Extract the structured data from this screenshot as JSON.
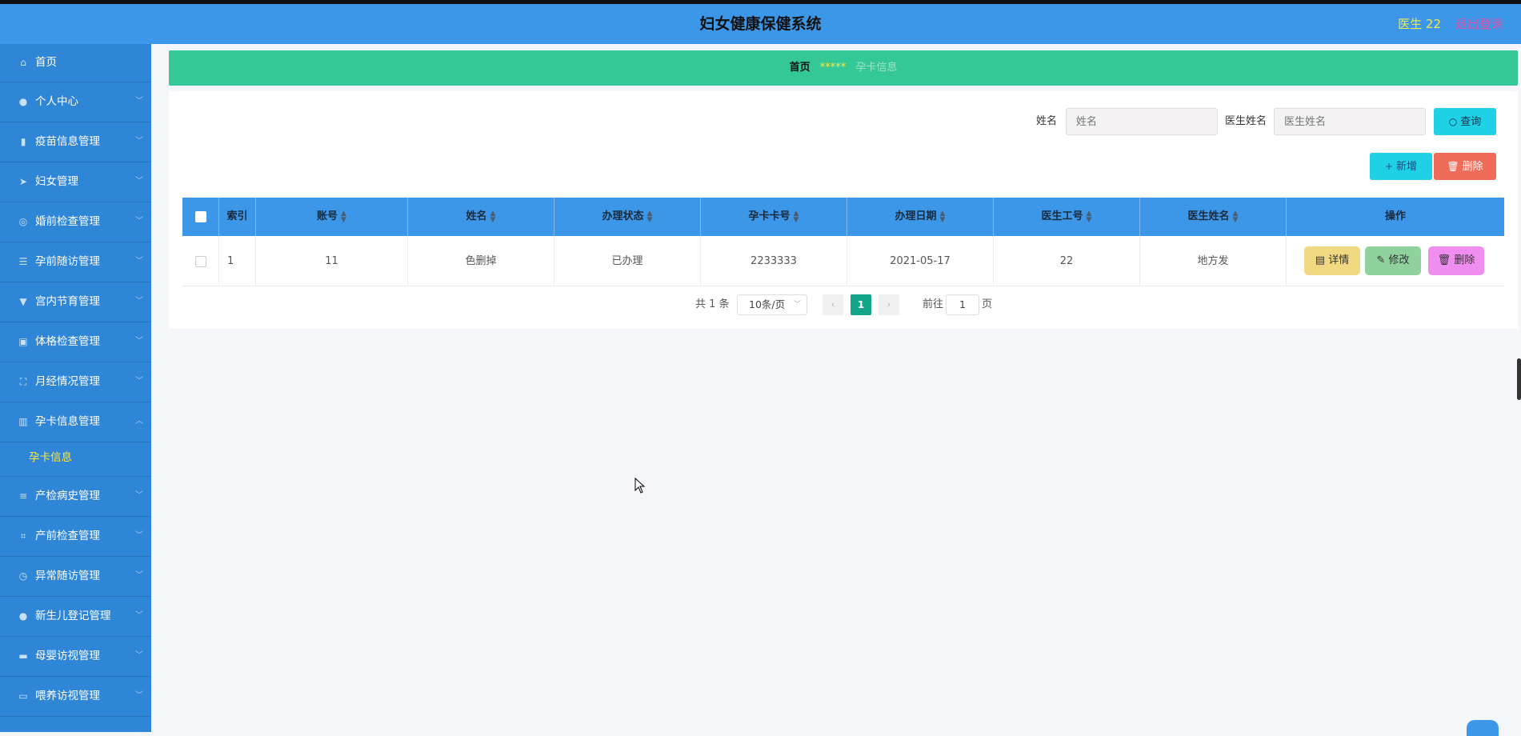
{
  "header": {
    "title": "妇女健康保健系统",
    "user": "医生 22",
    "logout": "退出登录"
  },
  "sidebar": {
    "items": [
      {
        "label": "首页",
        "icon": "home-icon"
      },
      {
        "label": "个人中心",
        "icon": "user-icon"
      },
      {
        "label": "疫苗信息管理",
        "icon": "microphone-icon"
      },
      {
        "label": "妇女管理",
        "icon": "send-icon"
      },
      {
        "label": "婚前检查管理",
        "icon": "compass-icon"
      },
      {
        "label": "孕前随访管理",
        "icon": "sliders-icon"
      },
      {
        "label": "宫内节育管理",
        "icon": "stamp-icon"
      },
      {
        "label": "体格检查管理",
        "icon": "clipboard-icon"
      },
      {
        "label": "月经情况管理",
        "icon": "fullscreen-icon"
      },
      {
        "label": "孕卡信息管理",
        "icon": "bar-chart-icon"
      },
      {
        "label": "产检病史管理",
        "icon": "list-icon"
      },
      {
        "label": "产前检查管理",
        "icon": "crop-icon"
      },
      {
        "label": "异常随访管理",
        "icon": "clock-icon"
      },
      {
        "label": "新生儿登记管理",
        "icon": "person-icon"
      },
      {
        "label": "母婴访视管理",
        "icon": "monitor-icon"
      },
      {
        "label": "喂养访视管理",
        "icon": "film-icon"
      }
    ],
    "sub_item": "孕卡信息"
  },
  "breadcrumb": {
    "home": "首页",
    "separator": "*****",
    "current": "孕卡信息"
  },
  "search": {
    "name_label": "姓名",
    "name_placeholder": "姓名",
    "doctor_label": "医生姓名",
    "doctor_placeholder": "医生姓名",
    "query_button": "查询"
  },
  "actions": {
    "add_button": "新增",
    "delete_button": "删除"
  },
  "table": {
    "headers": [
      "索引",
      "账号",
      "姓名",
      "办理状态",
      "孕卡卡号",
      "办理日期",
      "医生工号",
      "医生姓名",
      "操作"
    ],
    "rows": [
      {
        "index": "1",
        "account": "11",
        "name": "色删掉",
        "status": "已办理",
        "card_no": "2233333",
        "date": "2021-05-17",
        "doctor_id": "22",
        "doctor_name": "地方发"
      }
    ],
    "row_actions": {
      "detail": "详情",
      "edit": "修改",
      "delete": "删除"
    }
  },
  "pagination": {
    "total": "共 1 条",
    "page_size": "10条/页",
    "current_page": "1",
    "goto_label": "前往",
    "goto_value": "1",
    "page_suffix": "页"
  },
  "colors": {
    "header_bg": "#3d97e8",
    "sidebar_bg": "#2f85d6",
    "breadcrumb_bg": "#33c895",
    "accent_yellow": "#f7e84a"
  }
}
